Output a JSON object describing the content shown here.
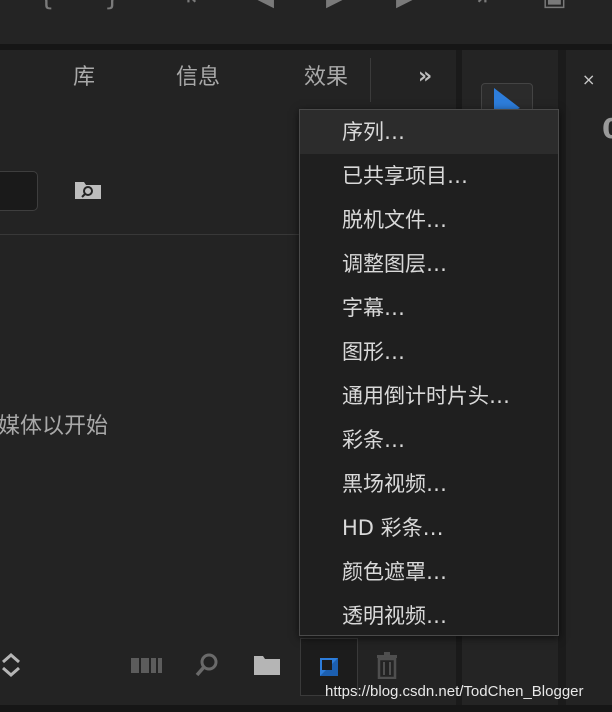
{
  "tabs": {
    "library": "库",
    "info": "信息",
    "effects": "效果",
    "overflow": "»"
  },
  "project": {
    "empty_hint": "媒体以开始"
  },
  "new_item_menu": {
    "items": [
      "序列…",
      "已共享项目…",
      "脱机文件…",
      "调整图层…",
      "字幕…",
      "图形…",
      "通用倒计时片头…",
      "彩条…",
      "黑场视频…",
      "HD 彩条…",
      "颜色遮罩…",
      "透明视频…"
    ]
  },
  "right_panel": {
    "close": "×",
    "partial_glyph": "0"
  },
  "watermark": "https://blog.csdn.net/TodChen_Blogger",
  "colors": {
    "accent_blue": "#2d7ddb",
    "menu_bg": "#1f1f1f",
    "panel_bg": "#232323"
  },
  "icons": [
    "sort-chevron-icon",
    "automate-to-sequence-icon",
    "find-icon",
    "new-bin-icon",
    "new-item-icon",
    "clear-trash-icon"
  ]
}
